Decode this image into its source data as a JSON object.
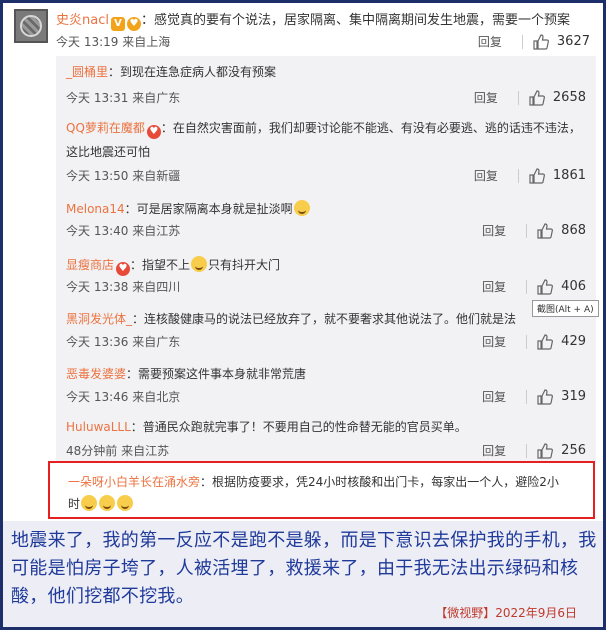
{
  "main_comment": {
    "username": "史炎nacl",
    "text": "：感觉真的要有个说法，居家隔离、集中隔离期间发生地震，需要一个预案",
    "time": "今天 13:19 来自上海",
    "reply_label": "回复",
    "likes": "3627"
  },
  "replies": [
    {
      "username": "_圆桶里",
      "text": "：到现在连急症病人都没有预案",
      "time": "今天 13:31 来自广东",
      "reply_label": "回复",
      "likes": "2658"
    },
    {
      "username": "QQ萝莉在魔都",
      "text": "：在自然灾害面前，我们却要讨论能不能逃、有没有必要逃、逃的话违不违法，这比地震还可怕",
      "time": "今天 13:50 来自新疆",
      "reply_label": "回复",
      "likes": "1861"
    },
    {
      "username": "Melona14",
      "text": "：可是居家隔离本身就是扯淡啊",
      "time": "今天 13:40 来自江苏",
      "reply_label": "回复",
      "likes": "868"
    },
    {
      "username": "显瘦商店",
      "text_a": "：指望不上",
      "text_b": "只有抖开大门",
      "time": "今天 13:38 来自四川",
      "reply_label": "回复",
      "likes": "406"
    },
    {
      "username": "黑洞发光体_",
      "text": "：连核酸健康马的说法已经放弃了，就不要奢求其他说法了。他们就是法",
      "time": "今天 13:36 来自广东",
      "reply_label": "回复",
      "likes": "429"
    },
    {
      "username": "恶毒发婆婆",
      "text": "：需要预案这件事本身就非常荒唐",
      "time": "今天 13:46 来自北京",
      "reply_label": "回复",
      "likes": "319"
    },
    {
      "username": "HuluwaLLL",
      "text": "：普通民众跑就完事了！不要用自己的性命替无能的官员买单。",
      "time": "48分钟前 来自江苏",
      "reply_label": "回复",
      "likes": "256"
    }
  ],
  "tooltip": "截图(Alt + A)",
  "highlighted_reply": {
    "username": "一朵呀小白羊长在涌水旁",
    "text_a": "：根据防疫要求，凭24小时核酸和出门卡，每家出一个人，避险2小",
    "text_b": "时"
  },
  "caption": {
    "text": "地震来了，我的第一反应不是跑不是躲，而是下意识去保护我的手机，我可能是怕房子垮了，人被活埋了，救援来了，由于我无法出示绿码和核酸，他们挖都不挖我。",
    "source": "【微视野】2022年9月6日"
  },
  "colors": {
    "username": "#eb7340",
    "border": "#1d2f6b",
    "highlight_border": "#e62020",
    "caption_text": "#1f3a9a",
    "source": "#c0392b"
  }
}
